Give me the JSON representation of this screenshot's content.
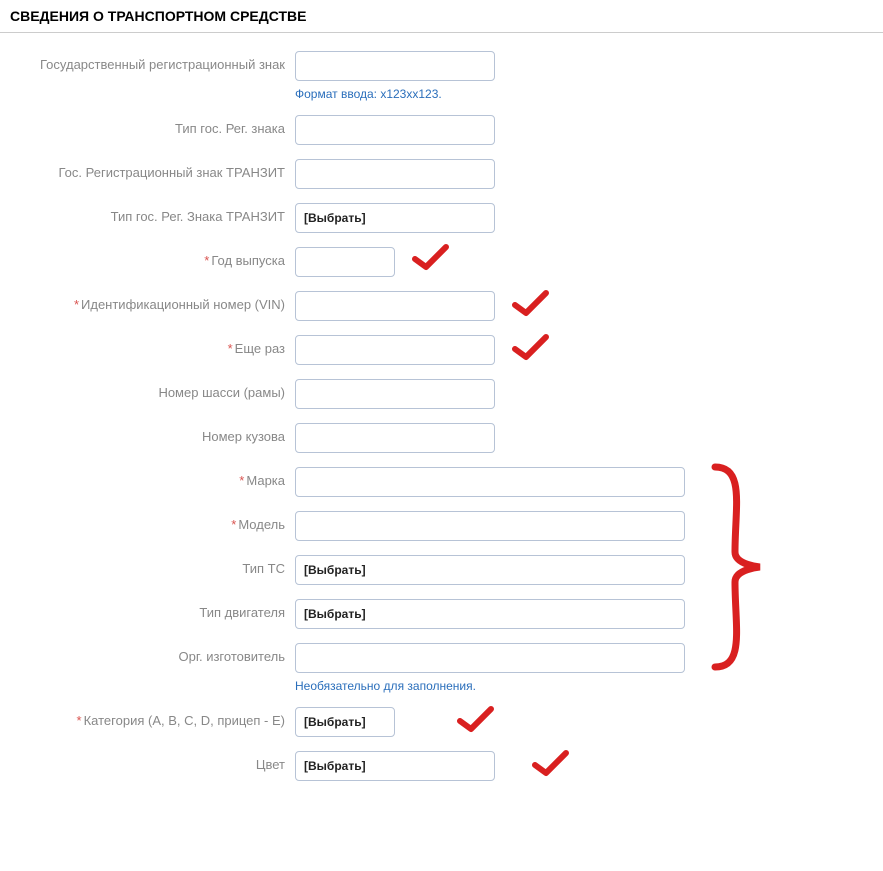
{
  "section_title": "СВЕДЕНИЯ О ТРАНСПОРТНОМ СРЕДСТВЕ",
  "fields": {
    "reg_plate": {
      "label": "Государственный регистрационный знак",
      "value": "",
      "hint": "Формат ввода: х123хх123."
    },
    "reg_plate_type": {
      "label": "Тип гос. Рег. знака",
      "value": ""
    },
    "transit_plate": {
      "label": "Гос. Регистрационный знак ТРАНЗИТ",
      "value": ""
    },
    "transit_plate_type": {
      "label": "Тип гос. Рег. Знака ТРАНЗИТ",
      "value": "[Выбрать]"
    },
    "year": {
      "label": "Год выпуска",
      "value": ""
    },
    "vin": {
      "label": "Идентификационный номер (VIN)",
      "value": ""
    },
    "vin_again": {
      "label": "Еще раз",
      "value": ""
    },
    "chassis": {
      "label": "Номер шасси (рамы)",
      "value": ""
    },
    "body_no": {
      "label": "Номер кузова",
      "value": ""
    },
    "brand": {
      "label": "Марка",
      "value": ""
    },
    "model": {
      "label": "Модель",
      "value": ""
    },
    "vehicle_type": {
      "label": "Тип ТС",
      "value": "[Выбрать]"
    },
    "engine_type": {
      "label": "Тип двигателя",
      "value": "[Выбрать]"
    },
    "manufacturer": {
      "label": "Орг. изготовитель",
      "value": "",
      "hint": "Необязательно для заполнения."
    },
    "category": {
      "label": "Категория (A, B, C, D, прицеп - E)",
      "value": "[Выбрать]"
    },
    "color": {
      "label": "Цвет",
      "value": "[Выбрать]"
    }
  },
  "colors": {
    "required": "#d9534f",
    "annotation": "#d92020"
  }
}
